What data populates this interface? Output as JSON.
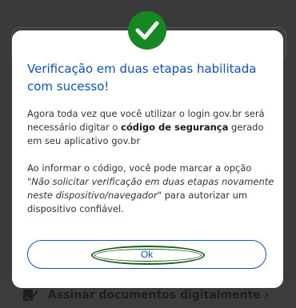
{
  "background": {
    "row_label": "Assinar documentos digitalmente",
    "row_icon": "sign-document-icon",
    "chevron_icon": "chevron-right-icon"
  },
  "modal": {
    "icon": "check-circle-icon",
    "title": "Verificação em duas etapas habilitada com sucesso!",
    "paragraph1": {
      "text_before": "Agora toda vez que você utilizar o login gov.br será necessário digitar o ",
      "bold": "código de segurança",
      "text_after": " gerado em seu aplicativo gov.br"
    },
    "paragraph2": {
      "text_before": "Ao informar o código, você pode marcar a opção ",
      "italic": "\"Não solicitar verificação em duas etapas novamente neste dispositivo/navegador\"",
      "text_after": " para autorizar um dispositivo confiável."
    },
    "ok_label": "Ok"
  },
  "colors": {
    "primary_blue": "#1351b4",
    "success_green": "#168821",
    "overlay": "#3a3a3a"
  }
}
